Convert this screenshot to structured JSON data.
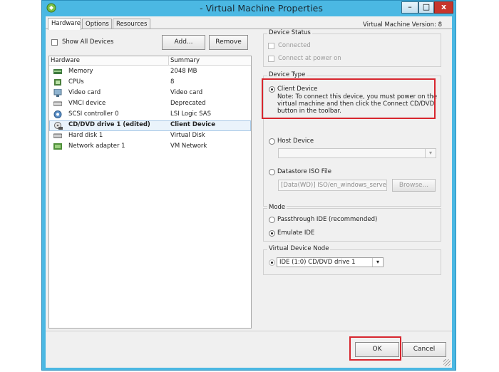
{
  "window": {
    "title": "- Virtual Machine Properties",
    "buttons": {
      "minimize": "–",
      "maximize": "□",
      "close": "x"
    }
  },
  "tabs": [
    "Hardware",
    "Options",
    "Resources"
  ],
  "vm_version": "Virtual Machine Version: 8",
  "show_all_devices": "Show All Devices",
  "add_button": "Add...",
  "remove_button": "Remove",
  "hardware_table": {
    "columns": [
      "Hardware",
      "Summary"
    ],
    "rows": [
      {
        "name": "Memory",
        "summary": "2048 MB",
        "icon": "memory-icon"
      },
      {
        "name": "CPUs",
        "summary": "8",
        "icon": "cpu-icon"
      },
      {
        "name": "Video card",
        "summary": "Video card",
        "icon": "monitor-icon"
      },
      {
        "name": "VMCI device",
        "summary": "Deprecated",
        "icon": "vmci-icon"
      },
      {
        "name": "SCSI controller 0",
        "summary": "LSI Logic SAS",
        "icon": "scsi-icon"
      },
      {
        "name": "CD/DVD drive 1 (edited)",
        "summary": "Client Device",
        "icon": "cd-dvd-icon",
        "selected": true
      },
      {
        "name": "Hard disk 1",
        "summary": "Virtual Disk",
        "icon": "hard-disk-icon"
      },
      {
        "name": "Network adapter 1",
        "summary": "VM Network",
        "icon": "network-adapter-icon"
      }
    ]
  },
  "device_status": {
    "legend": "Device Status",
    "connected": "Connected",
    "connect_at_power_on": "Connect at power on"
  },
  "device_type": {
    "legend": "Device Type",
    "client_device": "Client Device",
    "note": "Note: To connect this device, you must power on the virtual machine and then click the Connect CD/DVD button in the toolbar.",
    "host_device": "Host Device",
    "datastore_iso": "Datastore ISO File",
    "iso_path": "[Data(WD)] ISO/en_windows_server",
    "browse": "Browse..."
  },
  "mode": {
    "legend": "Mode",
    "passthrough": "Passthrough IDE (recommended)",
    "emulate": "Emulate IDE"
  },
  "virtual_device_node": {
    "legend": "Virtual Device Node",
    "selected": "IDE (1:0) CD/DVD drive 1"
  },
  "footer": {
    "ok": "OK",
    "cancel": "Cancel"
  },
  "colors": {
    "title_bar": "#4bb8e3",
    "highlight_box": "#d7262e",
    "close_button": "#c7352c"
  }
}
